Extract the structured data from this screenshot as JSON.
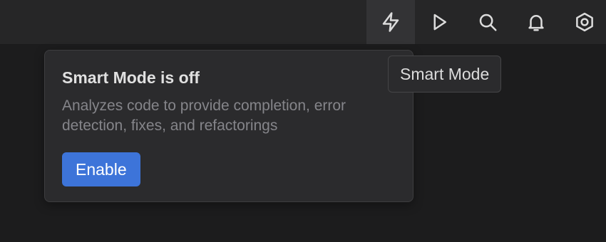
{
  "toolbar": {
    "buttons": [
      {
        "name": "smart-mode",
        "icon": "lightning-bolt-icon",
        "active": true
      },
      {
        "name": "run",
        "icon": "play-icon",
        "active": false
      },
      {
        "name": "search",
        "icon": "search-icon",
        "active": false
      },
      {
        "name": "notifications",
        "icon": "bell-icon",
        "active": false
      },
      {
        "name": "settings",
        "icon": "hexagon-gear-icon",
        "active": false
      }
    ]
  },
  "popup": {
    "title": "Smart Mode is off",
    "description": "Analyzes code to provide completion, error detection, fixes, and refactorings",
    "enable_label": "Enable"
  },
  "tooltip": {
    "text": "Smart Mode"
  },
  "colors": {
    "background": "#1c1c1d",
    "toolbar": "#262627",
    "popup": "#2b2b2d",
    "accent": "#3d74d9"
  }
}
